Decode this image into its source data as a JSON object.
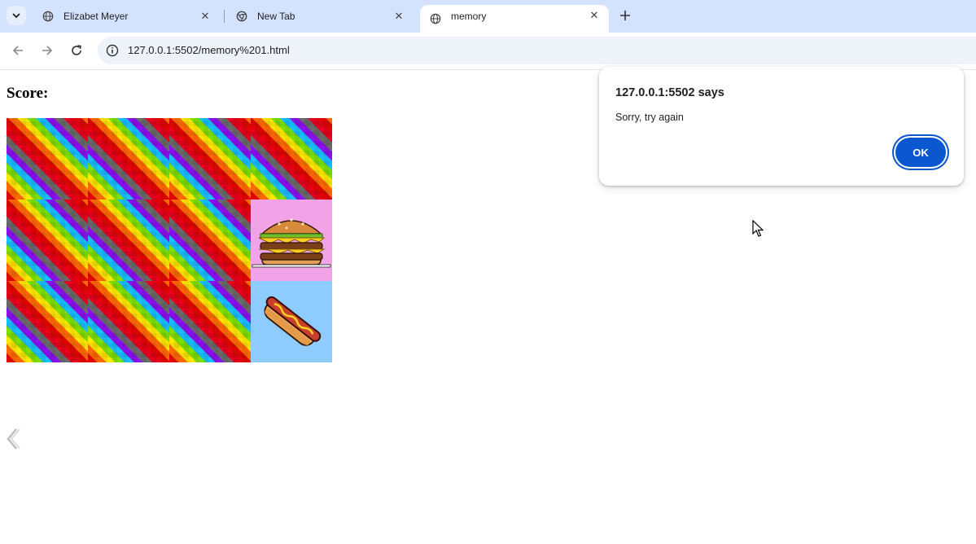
{
  "tabs": [
    {
      "title": "Elizabet Meyer",
      "active": false
    },
    {
      "title": "New Tab",
      "active": false
    },
    {
      "title": "memory",
      "active": true
    }
  ],
  "toolbar": {
    "url": "127.0.0.1:5502/memory%201.html"
  },
  "page": {
    "score_label": "Score:",
    "cards": [
      {
        "state": "back"
      },
      {
        "state": "back"
      },
      {
        "state": "back"
      },
      {
        "state": "back"
      },
      {
        "state": "back"
      },
      {
        "state": "back"
      },
      {
        "state": "back"
      },
      {
        "state": "face",
        "image": "burger"
      },
      {
        "state": "back"
      },
      {
        "state": "back"
      },
      {
        "state": "back"
      },
      {
        "state": "face",
        "image": "hotdog"
      }
    ]
  },
  "dialog": {
    "title": "127.0.0.1:5502 says",
    "message": "Sorry, try again",
    "ok_label": "OK"
  },
  "colors": {
    "tabstrip": "#d3e3fd",
    "accent": "#0b57d0",
    "burger_card": "#f2a3e8",
    "hotdog_card": "#8ecbff"
  }
}
